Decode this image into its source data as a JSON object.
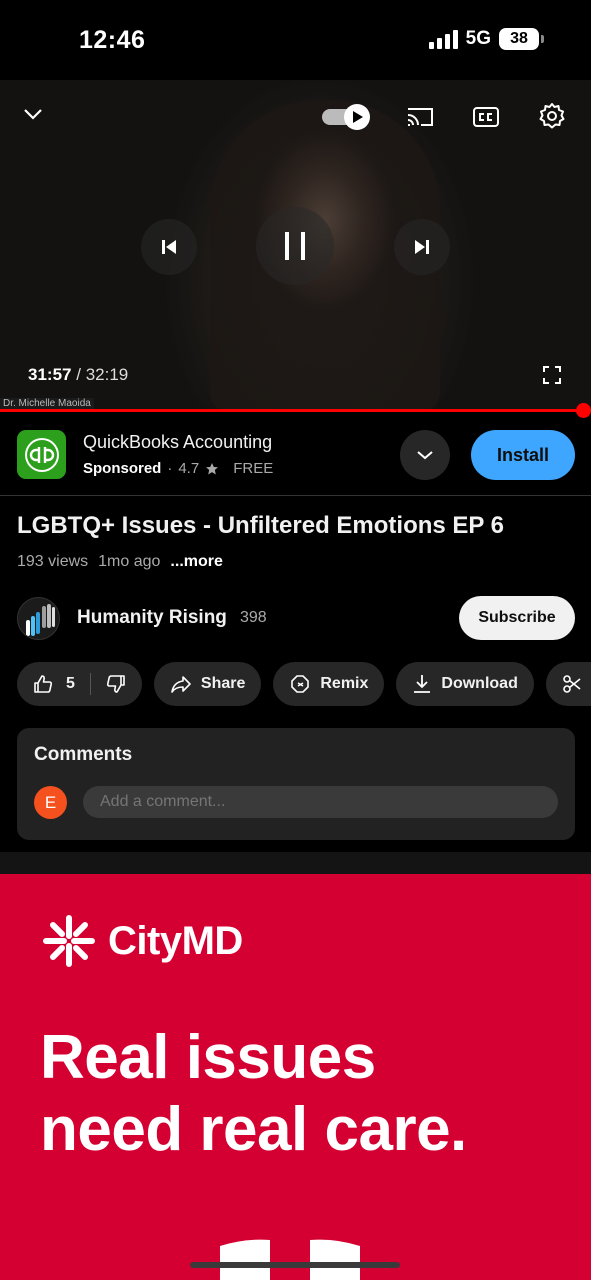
{
  "status_bar": {
    "time": "12:46",
    "network": "5G",
    "battery": "38"
  },
  "player": {
    "current_time": "31:57",
    "separator": "/",
    "duration": "32:19",
    "watermark": "Dr. Michelle Maoida",
    "progress_fraction": 0.988
  },
  "ad": {
    "app_name": "QuickBooks Accounting",
    "sponsored_label": "Sponsored",
    "dot": "·",
    "rating": "4.7",
    "price": "FREE",
    "install_label": "Install",
    "logo_text": "qb"
  },
  "video": {
    "title": "LGBTQ+ Issues - Unfiltered Emotions EP 6",
    "views": "193 views",
    "age": "1mo ago",
    "more_label": "...more"
  },
  "channel": {
    "name": "Humanity Rising",
    "subscribers": "398",
    "subscribe_label": "Subscribe"
  },
  "actions": {
    "like_count": "5",
    "share_label": "Share",
    "remix_label": "Remix",
    "download_label": "Download",
    "clip_label": "C"
  },
  "comments": {
    "title": "Comments",
    "avatar_letter": "E",
    "placeholder": "Add a comment..."
  },
  "banner": {
    "brand": "CityMD",
    "headline_line1": "Real issues",
    "headline_line2": "need real care."
  },
  "colors": {
    "accent_red": "#ff0000",
    "install_blue": "#3ea6ff",
    "quickbooks_green": "#2ca01c",
    "citymd_red": "#d50032"
  }
}
